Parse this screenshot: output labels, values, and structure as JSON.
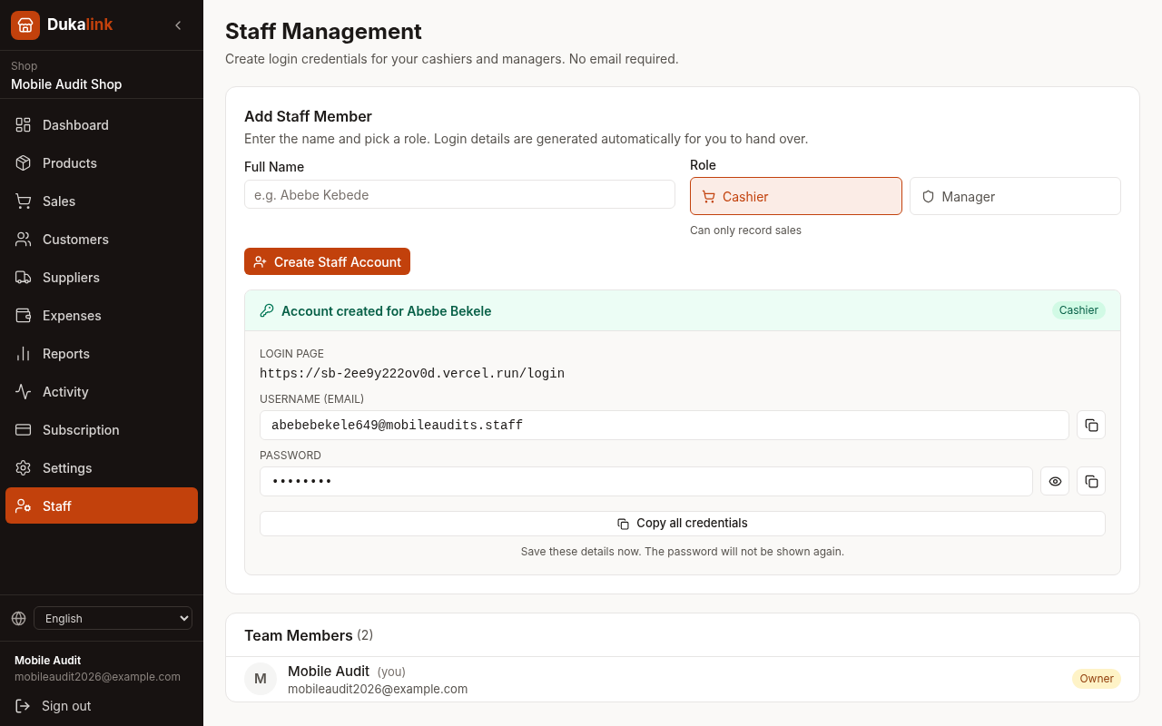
{
  "brand": {
    "name_main": "Duka",
    "name_accent": "link"
  },
  "shop": {
    "label": "Shop",
    "name": "Mobile Audit Shop"
  },
  "nav": [
    {
      "label": "Dashboard",
      "selected": false
    },
    {
      "label": "Products",
      "selected": false
    },
    {
      "label": "Sales",
      "selected": false
    },
    {
      "label": "Customers",
      "selected": false
    },
    {
      "label": "Suppliers",
      "selected": false
    },
    {
      "label": "Expenses",
      "selected": false
    },
    {
      "label": "Reports",
      "selected": false
    },
    {
      "label": "Activity",
      "selected": false
    },
    {
      "label": "Subscription",
      "selected": false
    },
    {
      "label": "Settings",
      "selected": false
    },
    {
      "label": "Staff",
      "selected": true
    }
  ],
  "language": {
    "value": "English"
  },
  "user": {
    "name": "Mobile Audit",
    "email": "mobileaudit2026@example.com"
  },
  "sign_out": "Sign out",
  "page": {
    "title": "Staff Management",
    "subtitle": "Create login credentials for your cashiers and managers. No email required."
  },
  "add_form": {
    "title": "Add Staff Member",
    "description": "Enter the name and pick a role. Login details are generated automatically for you to hand over.",
    "full_name": {
      "label": "Full Name",
      "placeholder": "e.g. Abebe Kebede"
    },
    "role": {
      "label": "Role",
      "hint": "Can only record sales",
      "options": [
        {
          "label": "Cashier",
          "selected": true
        },
        {
          "label": "Manager",
          "selected": false
        }
      ]
    },
    "submit": "Create Staff Account"
  },
  "result": {
    "title": "Account created for Abebe Bekele",
    "role_badge": "Cashier",
    "login_page": {
      "label": "LOGIN PAGE",
      "value": "https://sb-2ee9y222ov0d.vercel.run/login"
    },
    "username": {
      "label": "USERNAME (EMAIL)",
      "value": "abebebekele649@mobileaudits.staff"
    },
    "password": {
      "label": "PASSWORD",
      "value": "••••••••"
    },
    "copy_all": "Copy all credentials",
    "note": "Save these details now. The password will not be shown again."
  },
  "team": {
    "title": "Team Members",
    "count": "(2)",
    "members": [
      {
        "initial": "M",
        "name": "Mobile Audit",
        "tag": "(you)",
        "email": "mobileaudit2026@example.com",
        "role": "Owner"
      }
    ]
  }
}
